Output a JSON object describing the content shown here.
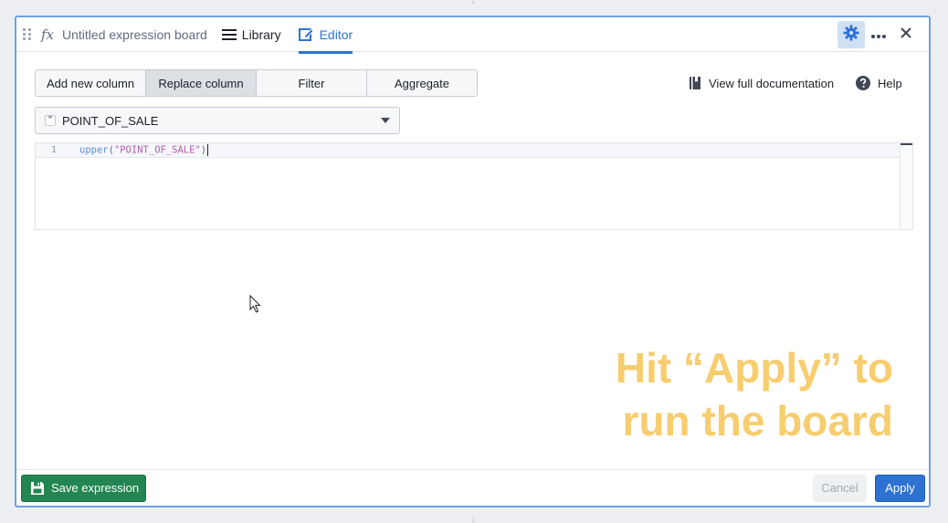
{
  "header": {
    "board_title": "Untitled expression board",
    "tabs": [
      {
        "label": "Library",
        "icon": "list-icon"
      },
      {
        "label": "Editor",
        "icon": "edit-icon",
        "active": true
      }
    ]
  },
  "toolbar": {
    "modes": [
      {
        "label": "Add new column",
        "active": false
      },
      {
        "label": "Replace column",
        "active": true
      },
      {
        "label": "Filter",
        "active": false
      },
      {
        "label": "Aggregate",
        "active": false
      }
    ],
    "doc_link_label": "View full documentation",
    "help_label": "Help"
  },
  "column_select": {
    "type_glyph": "\"",
    "value": "POINT_OF_SALE"
  },
  "editor": {
    "line_number": "1",
    "code_fn": "upper",
    "code_open": "(",
    "code_str": "\"POINT_OF_SALE\"",
    "code_close": ")"
  },
  "overlay": {
    "line1": "Hit “Apply” to",
    "line2": "run the board"
  },
  "footer": {
    "save_label": "Save expression",
    "cancel_label": "Cancel",
    "apply_label": "Apply"
  },
  "colors": {
    "accent": "#2d72d2",
    "save_green": "#238551",
    "overlay_yellow": "#f7cd6e"
  }
}
